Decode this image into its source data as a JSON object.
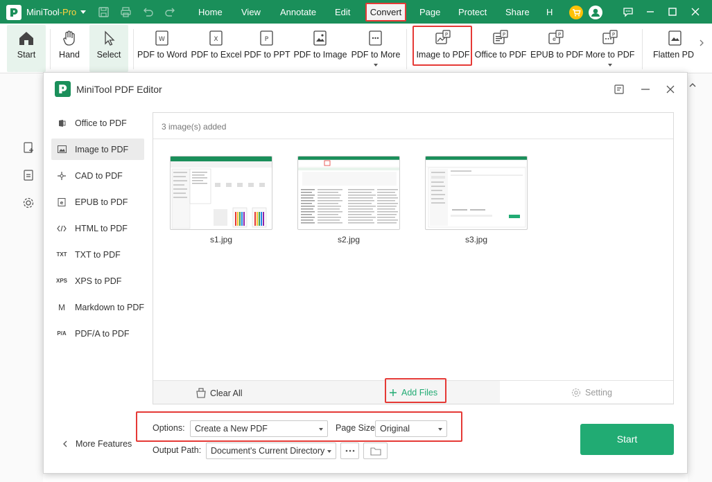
{
  "app": {
    "name": "MiniTool",
    "edition": "-Pro"
  },
  "menu": [
    "Home",
    "View",
    "Annotate",
    "Edit",
    "Convert",
    "Page",
    "Protect",
    "Share",
    "H"
  ],
  "ribbon": {
    "start": "Start",
    "hand": "Hand",
    "select": "Select",
    "items": [
      "PDF to Word",
      "PDF to Excel",
      "PDF to PPT",
      "PDF to Image",
      "PDF to More",
      "Image to PDF",
      "Office to PDF",
      "EPUB to PDF",
      "More to PDF",
      "Flatten PD"
    ]
  },
  "dialog": {
    "title": "MiniTool PDF Editor",
    "nav": [
      {
        "label": "Office to PDF",
        "icon": "office-icon"
      },
      {
        "label": "Image to PDF",
        "icon": "image-icon"
      },
      {
        "label": "CAD to PDF",
        "icon": "cad-icon"
      },
      {
        "label": "EPUB to PDF",
        "icon": "epub-icon"
      },
      {
        "label": "HTML to PDF",
        "icon": "html-icon"
      },
      {
        "label": "TXT to PDF",
        "icon": "txt-icon"
      },
      {
        "label": "XPS to PDF",
        "icon": "xps-icon"
      },
      {
        "label": "Markdown to PDF",
        "icon": "markdown-icon"
      },
      {
        "label": "PDF/A to PDF",
        "icon": "pdfa-icon"
      }
    ],
    "nav_icon_text": {
      "txt": "TXT",
      "xps": "XPS",
      "markdown": "M",
      "pdfa": "P/A"
    },
    "active_nav": "Image to PDF",
    "image_count_text": "3 image(s) added",
    "files": [
      "s1.jpg",
      "s2.jpg",
      "s3.jpg"
    ],
    "footer": {
      "clear_all": "Clear All",
      "add_files": "Add Files",
      "setting": "Setting"
    },
    "options_label": "Options:",
    "options_value": "Create a New PDF",
    "page_size_label": "Page Size:",
    "page_size_value": "Original",
    "output_path_label": "Output Path:",
    "output_path_value": "Document's Current Directory",
    "more_features": "More Features",
    "start_button": "Start"
  },
  "colors": {
    "brand_green": "#1a8f5a",
    "accent_green": "#21ab73",
    "highlight_red": "#e53935"
  }
}
